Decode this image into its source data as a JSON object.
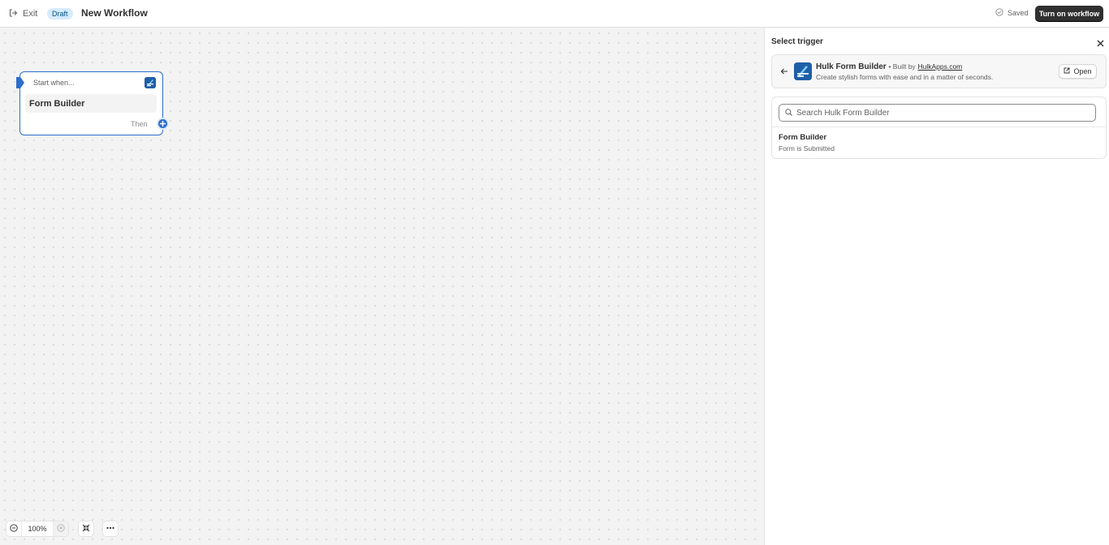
{
  "header": {
    "exit_label": "Exit",
    "status_badge": "Draft",
    "workflow_title": "New Workflow",
    "saved_label": "Saved",
    "turn_on_label": "Turn on workflow"
  },
  "canvas": {
    "trigger_node": {
      "heading": "Start when...",
      "title": "Form Builder",
      "next_label": "Then"
    },
    "zoom": {
      "level": "100%"
    }
  },
  "panel": {
    "title": "Select trigger",
    "app": {
      "name": "Hulk Form Builder",
      "built_by_prefix": "• Built by",
      "built_by_link": "HulkApps.com",
      "description": "Create stylish forms with ease and in a matter of seconds.",
      "open_label": "Open"
    },
    "search": {
      "placeholder": "Search Hulk Form Builder",
      "value": ""
    },
    "triggers": [
      {
        "title": "Form Builder",
        "subtitle": "Form is Submitted"
      }
    ]
  },
  "colors": {
    "accent": "#2c6ecb",
    "primary_button": "#303030",
    "badge_bg": "#d5ebff",
    "app_logo": "#1f5fa8"
  },
  "icons": [
    "exit-icon",
    "check-circle-icon",
    "app-logo-icon",
    "plus-icon",
    "zoom-out-icon",
    "zoom-in-icon",
    "fit-view-icon",
    "more-icon",
    "close-icon",
    "back-arrow-icon",
    "external-link-icon",
    "search-icon"
  ]
}
